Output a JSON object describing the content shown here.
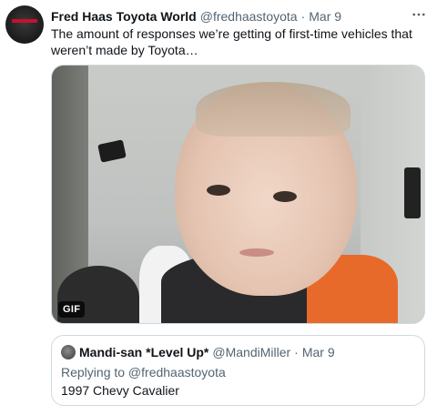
{
  "tweet": {
    "author": {
      "display_name": "Fred Haas Toyota World",
      "handle": "@fredhaastoyota",
      "separator": "·",
      "date": "Mar 9",
      "avatar_icon": "dealership-logo-avatar"
    },
    "text": "The amount of responses we’re getting of first-time vehicles that weren’t made by Toyota…",
    "more_icon": "more-dots-icon",
    "media": {
      "badge": "GIF",
      "description_icon": "gif-thumbnail"
    }
  },
  "quoted_tweet": {
    "author": {
      "display_name": "Mandi-san *Level Up*",
      "handle": "@MandiMiller",
      "separator": "·",
      "date": "Mar 9",
      "avatar_icon": "user-avatar"
    },
    "replying_to": "Replying to @fredhaastoyota",
    "text": "1997 Chevy Cavalier"
  },
  "colors": {
    "text_primary": "#0f1419",
    "text_secondary": "#536471",
    "border": "#cfd9de",
    "brand_red": "#c8102e"
  }
}
